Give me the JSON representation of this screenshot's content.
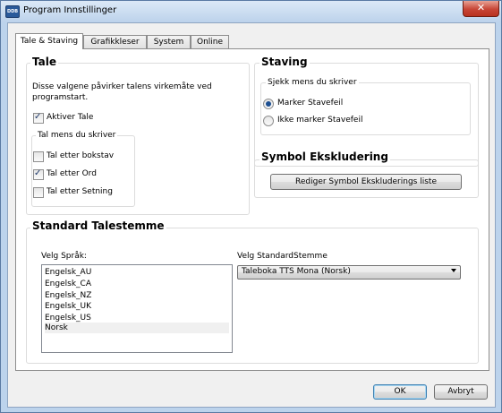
{
  "window": {
    "title": "Program Innstillinger",
    "close_glyph": "✕"
  },
  "tabs": [
    {
      "label": "Tale & Staving",
      "active": true
    },
    {
      "label": "Grafikkleser",
      "active": false
    },
    {
      "label": "System",
      "active": false
    },
    {
      "label": "Online",
      "active": false
    }
  ],
  "tale": {
    "title": "Tale",
    "description_line1": "Disse valgene påvirker talens virkemåte ved",
    "description_line2": "programstart.",
    "aktiver_tale": {
      "label": "Aktiver Tale",
      "checked": true
    },
    "tal_mens": {
      "title": "Tal mens du skriver",
      "options": [
        {
          "label": "Tal etter bokstav",
          "checked": false
        },
        {
          "label": "Tal etter Ord",
          "checked": true
        },
        {
          "label": "Tal etter Setning",
          "checked": false
        }
      ]
    }
  },
  "staving": {
    "title": "Staving",
    "sjekk": {
      "title": "Sjekk mens du skriver",
      "options": [
        {
          "label": "Marker Stavefeil",
          "selected": true
        },
        {
          "label": "Ikke marker Stavefeil",
          "selected": false
        }
      ]
    }
  },
  "symbol": {
    "title": "Symbol Ekskludering",
    "button_label": "Rediger Symbol Ekskluderings liste"
  },
  "standard": {
    "title": "Standard Talestemme",
    "language_label": "Velg Språk:",
    "languages": [
      "Engelsk_AU",
      "Engelsk_CA",
      "Engelsk_NZ",
      "Engelsk_UK",
      "Engelsk_US",
      "Norsk"
    ],
    "selected_language": "Norsk",
    "voice_label": "Velg StandardStemme",
    "voice_value": "Taleboka TTS Mona (Norsk)"
  },
  "footer": {
    "ok_label": "OK",
    "cancel_label": "Avbryt"
  },
  "icons": {
    "check_glyph": "✓",
    "app_icon_text": "DDB"
  }
}
